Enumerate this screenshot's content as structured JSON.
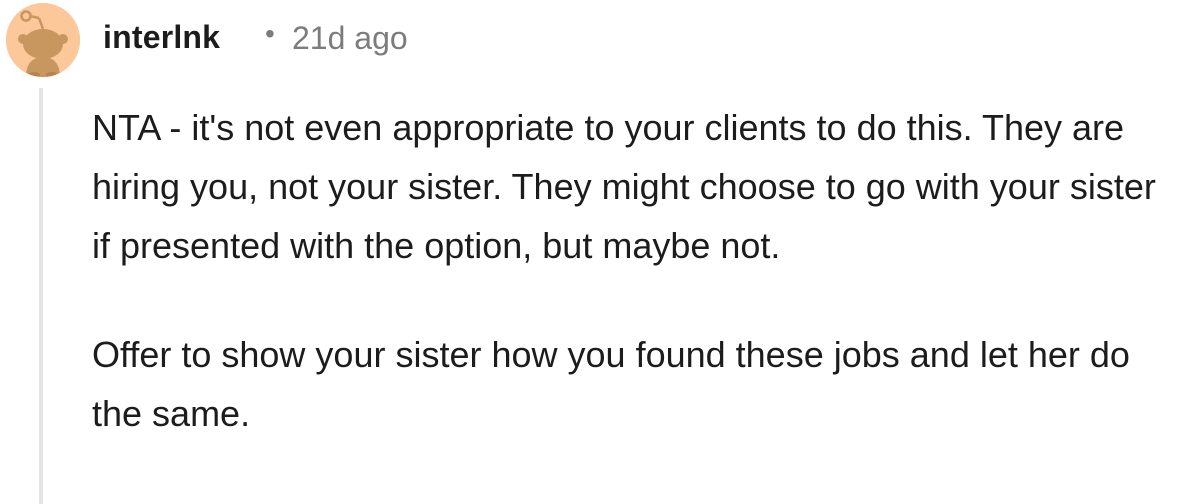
{
  "comment": {
    "author": "interlnk",
    "separator": "•",
    "timestamp": "21d ago",
    "avatar_icon": "reddit-snoo-avatar-icon",
    "paragraphs": [
      "NTA - it's not even appropriate to your clients to do this. They are hiring you, not your sister. They might choose to go with your sister if presented with the option, but maybe not.",
      "Offer to show your sister how you found these jobs and let her do the same."
    ]
  },
  "colors": {
    "avatar_bg": "#fcc89a",
    "avatar_figure": "#c8965f",
    "meta_text": "#7c7c7c",
    "thread_line": "#e5e5e5"
  }
}
